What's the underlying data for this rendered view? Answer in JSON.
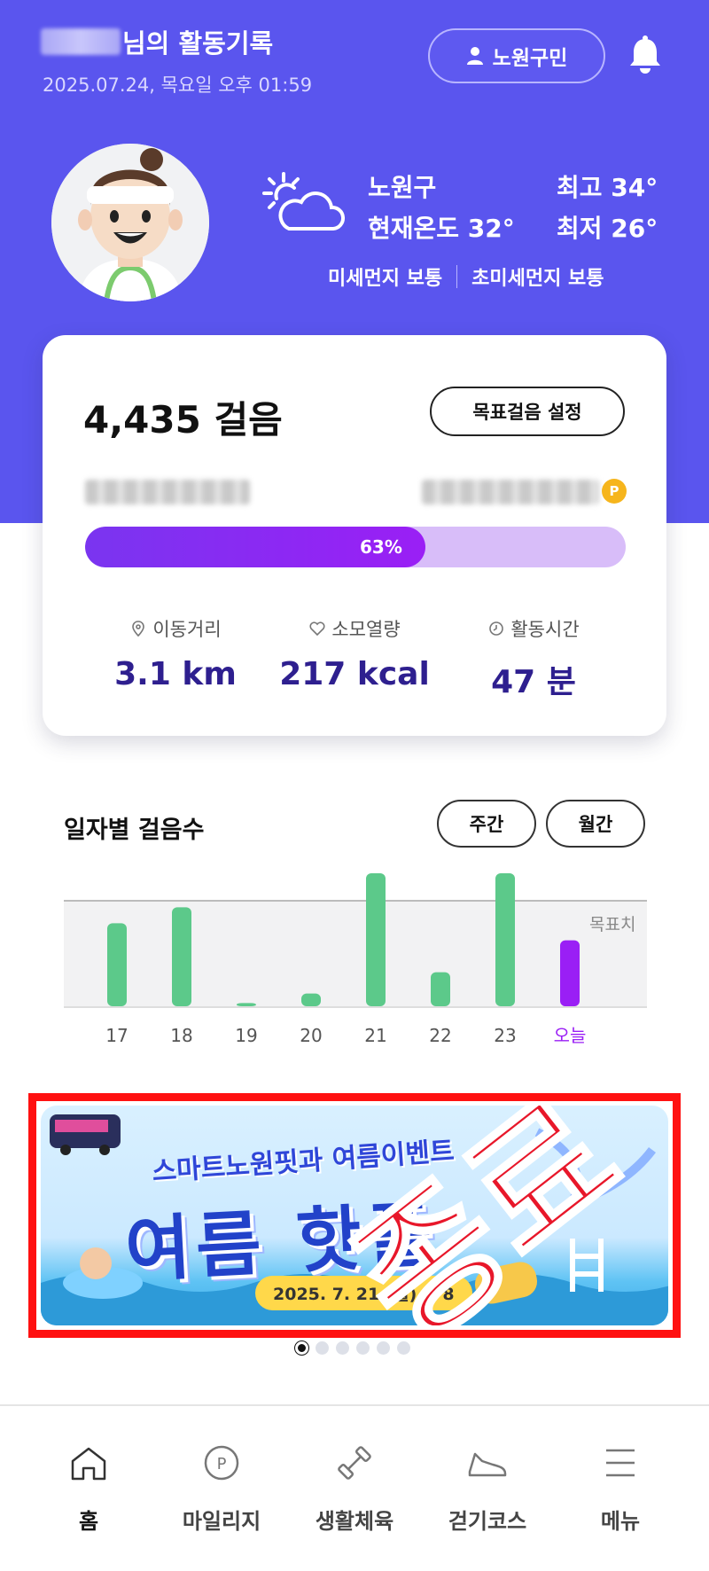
{
  "header": {
    "title": "님의 활동기록",
    "datetime": "2025.07.24, 목요일 오후 01:59",
    "resident_button": "노원구민"
  },
  "weather": {
    "region": "노원구",
    "current": "현재온도 32°",
    "high": "최고 34°",
    "low": "최저 26°",
    "fine_dust": "미세먼지 보통",
    "ultra_fine_dust": "초미세먼지 보통",
    "icon": "partly-cloudy-icon"
  },
  "activity": {
    "steps": "4,435 걸음",
    "goal_button": "목표걸음 설정",
    "progress_label": "63%",
    "progress": 0.63,
    "distance_label": "이동거리",
    "distance": "3.1 km",
    "calories_label": "소모열량",
    "calories": "217 kcal",
    "time_label": "활동시간",
    "time": "47 분",
    "point_icon": "P"
  },
  "daily": {
    "title": "일자별 걸음수",
    "tab_week": "주간",
    "tab_month": "월간",
    "goal_line_label": "목표치"
  },
  "chart_data": {
    "type": "bar",
    "categories": [
      "17",
      "18",
      "19",
      "20",
      "21",
      "22",
      "23",
      "오늘"
    ],
    "values": [
      0.78,
      0.93,
      0.03,
      0.12,
      1.25,
      0.32,
      1.25,
      0.62
    ],
    "goal": 1.0,
    "value_unit": "fraction of goal",
    "colors": {
      "past": "#5cc98a",
      "today": "#9a1ff5"
    },
    "grid": false
  },
  "banner": {
    "subtitle": "스마트노원핏과 여름이벤트",
    "headline": "여름 핫플",
    "date": "2025. 7. 21.(월) ~ 8",
    "closed_stamp": "종료",
    "slide_count": 6,
    "active_slide": 1
  },
  "nav": {
    "items": [
      {
        "label": "홈",
        "icon": "home-icon"
      },
      {
        "label": "마일리지",
        "icon": "mileage-icon"
      },
      {
        "label": "생활체육",
        "icon": "dumbbell-icon"
      },
      {
        "label": "걷기코스",
        "icon": "shoe-icon"
      },
      {
        "label": "메뉴",
        "icon": "menu-icon"
      }
    ]
  }
}
